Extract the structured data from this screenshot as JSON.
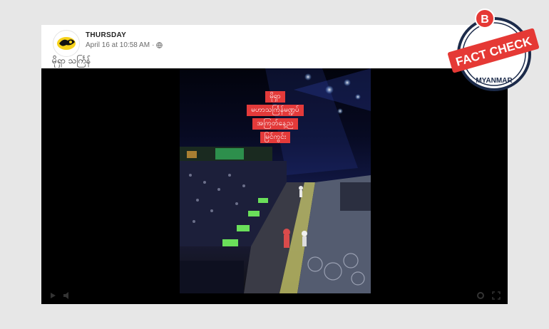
{
  "post": {
    "author": "THURSDAY",
    "timestamp": "April 16 at 10:58 AM",
    "separator": "·",
    "privacy_icon": "globe-icon",
    "caption": "မိုရှာ သင်္ကြန်"
  },
  "video": {
    "overlay_lines": [
      "မိုရှာ",
      "မဟာသင်္ကြန်မဏ္ဍပ်",
      "အကြတ်နေ့ည",
      "မြင်ကွင်း"
    ],
    "controls": [
      "play-icon",
      "volume-icon",
      "settings-icon",
      "fullscreen-icon"
    ]
  },
  "badge": {
    "letter": "B",
    "label": "FACT CHECK",
    "sublabel": "MYANMAR",
    "colors": {
      "red": "#e53935",
      "navy": "#1c2b4a"
    }
  }
}
